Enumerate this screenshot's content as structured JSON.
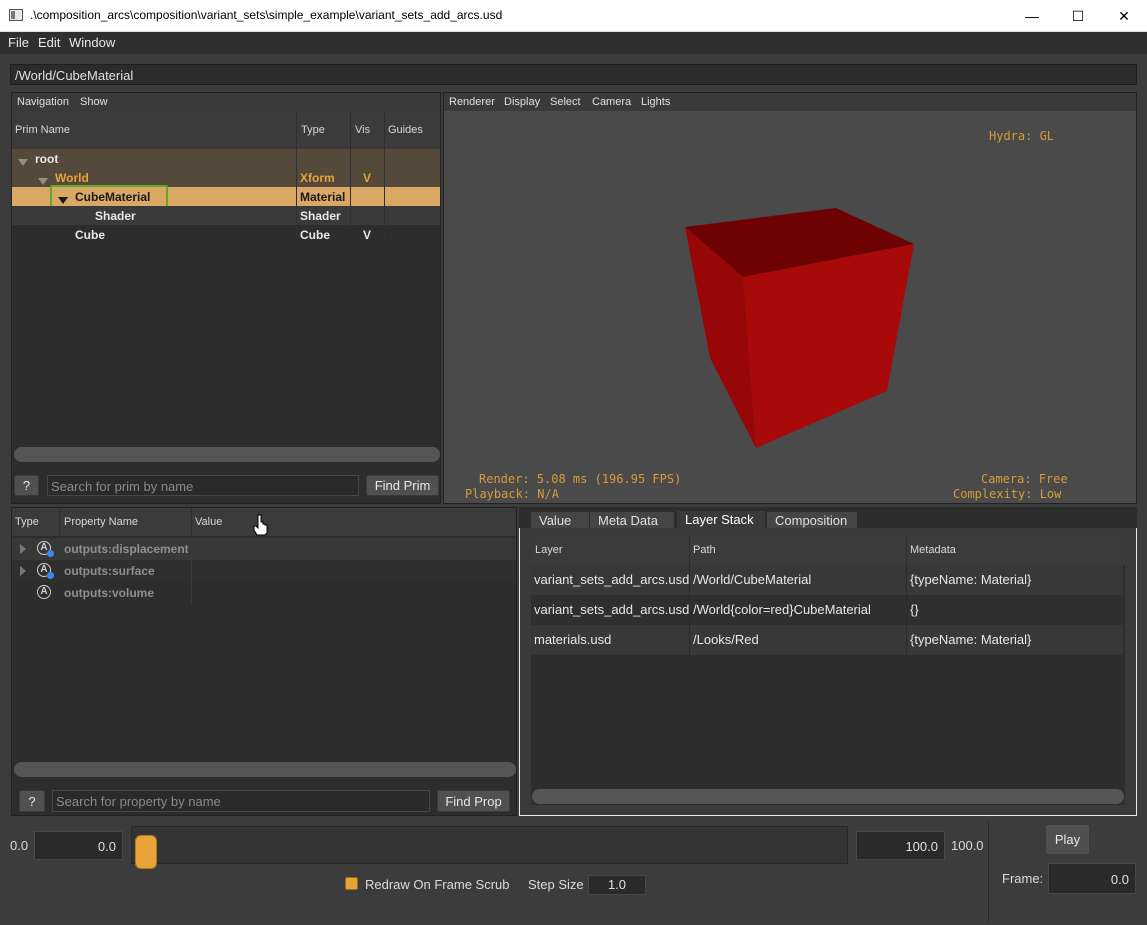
{
  "window": {
    "title": ".\\composition_arcs\\composition\\variant_sets\\simple_example\\variant_sets_add_arcs.usd",
    "min": "—",
    "max": "☐",
    "close": "✕"
  },
  "menu": [
    "File",
    "Edit",
    "Window"
  ],
  "path": "/World/CubeMaterial",
  "prim_panel": {
    "menu": [
      "Navigation",
      "Show"
    ],
    "columns": [
      "Prim Name",
      "Type",
      "Vis",
      "Guides"
    ],
    "rows": [
      {
        "name": "root",
        "type": "",
        "vis": ""
      },
      {
        "name": "World",
        "type": "Xform",
        "vis": "V"
      },
      {
        "name": "CubeMaterial",
        "type": "Material",
        "vis": ""
      },
      {
        "name": "Shader",
        "type": "Shader",
        "vis": ""
      },
      {
        "name": "Cube",
        "type": "Cube",
        "vis": "V"
      }
    ],
    "help": "?",
    "search_placeholder": "Search for prim by name",
    "find": "Find Prim"
  },
  "viewport": {
    "menu": [
      "Renderer",
      "Display",
      "Select",
      "Camera",
      "Lights"
    ],
    "renderer": "Hydra: GL",
    "render_stats": "Render: 5.08 ms (196.95 FPS)",
    "playback": "Playback: N/A",
    "camera": "Camera: Free",
    "complexity": "Complexity: Low",
    "cube_color": "#8b0000"
  },
  "property_panel": {
    "columns": [
      "Type",
      "Property Name",
      "Value"
    ],
    "rows": [
      {
        "name": "outputs:displacement",
        "expandable": true
      },
      {
        "name": "outputs:surface",
        "expandable": true
      },
      {
        "name": "outputs:volume",
        "expandable": false
      }
    ],
    "attr_icon": "A",
    "help": "?",
    "search_placeholder": "Search for property by name",
    "find": "Find Prop"
  },
  "inspector": {
    "tabs": [
      "Value",
      "Meta Data",
      "Layer Stack",
      "Composition"
    ],
    "active_tab": "Layer Stack",
    "columns": [
      "Layer",
      "Path",
      "Metadata"
    ],
    "rows": [
      {
        "layer": "variant_sets_add_arcs.usd",
        "path": "/World/CubeMaterial",
        "metadata": "{typeName: Material}"
      },
      {
        "layer": "variant_sets_add_arcs.usd",
        "path": "/World{color=red}CubeMaterial",
        "metadata": "{}"
      },
      {
        "layer": "materials.usd",
        "path": "/Looks/Red",
        "metadata": "{typeName: Material}"
      }
    ]
  },
  "timeline": {
    "start_label": "0.0",
    "start_value": "0.0",
    "end_value": "100.0",
    "end_label": "100.0",
    "play": "Play",
    "redraw": "Redraw On Frame Scrub",
    "step_label": "Step Size",
    "step_value": "1.0",
    "frame_label": "Frame:",
    "frame_value": "0.0",
    "accent": "#e8a33a"
  }
}
